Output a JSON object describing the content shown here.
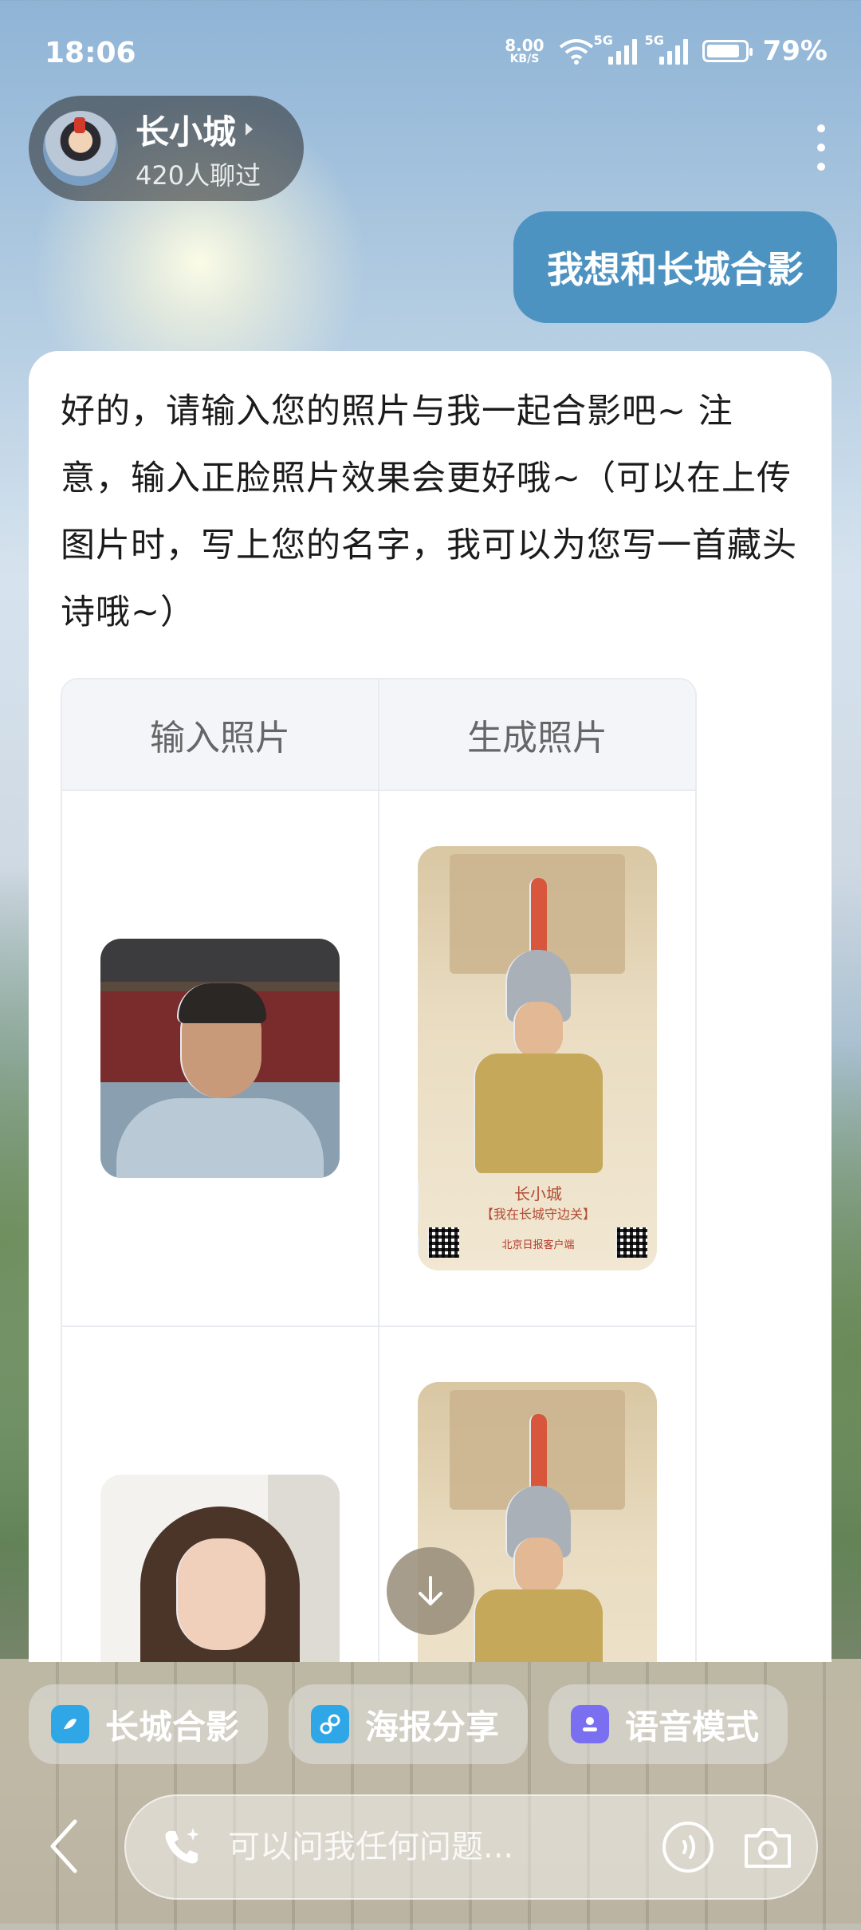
{
  "status_bar": {
    "time": "18:06",
    "net_speed_value": "8.00",
    "net_speed_unit": "KB/S",
    "signal1_label": "5G",
    "signal2_label": "5G",
    "battery": "79%"
  },
  "header": {
    "name": "长小城",
    "subtitle": "420人聊过"
  },
  "user_message": "我想和长城合影",
  "bot_message": {
    "text": "好的，请输入您的照片与我一起合影吧~ 注意，输入正脸照片效果会更好哦~（可以在上传图片时，写上您的名字，我可以为您写一首藏头诗哦~）",
    "table": {
      "headers": [
        "输入照片",
        "生成照片"
      ],
      "poster_caption": "长小城",
      "poster_subcaption": "【我在长城守边关】",
      "poster_brand": "北京日报客户端"
    }
  },
  "quick_actions": [
    {
      "label": "长城合影",
      "icon": "photo-icon"
    },
    {
      "label": "海报分享",
      "icon": "link-icon"
    },
    {
      "label": "语音模式",
      "icon": "voice-mode-icon"
    }
  ],
  "input": {
    "placeholder": "可以问我任何问题..."
  },
  "colors": {
    "user_bubble": "#4d93c2",
    "accent_blue": "#2fa6e6",
    "accent_purple": "#7a6ff0"
  }
}
